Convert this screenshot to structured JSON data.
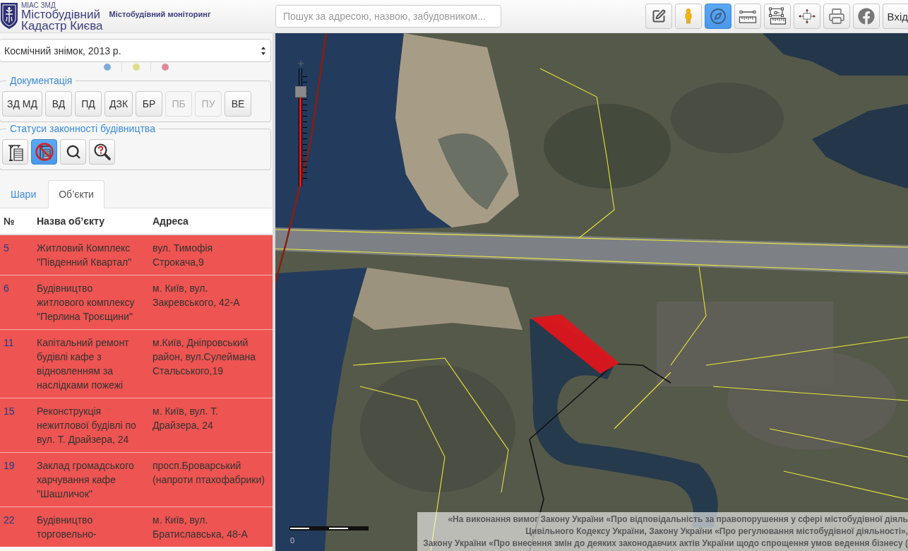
{
  "header": {
    "org": "МІАС ЗМД",
    "title_lines": [
      "Містобудівний",
      "Кадастр Києва"
    ],
    "subtitle": "Містобудівний моніторинг"
  },
  "search": {
    "placeholder": "Пошук за адресою, назвою, забудовником..."
  },
  "toolbar": {
    "buttons": [
      {
        "selected": false
      },
      {
        "selected": false
      },
      {
        "selected": true
      },
      {
        "selected": false
      },
      {
        "selected": false
      },
      {
        "selected": false
      },
      {
        "selected": false
      },
      {
        "selected": false
      }
    ],
    "login": "Вхід"
  },
  "sidebar": {
    "basemap_select": {
      "value": "Космічний знімок, 2013 р."
    },
    "layer_dots": [
      {
        "color": "#80aad9"
      },
      {
        "color": "#dcde8a"
      },
      {
        "color": "#de8a9c"
      }
    ],
    "documentation": {
      "legend": "Документація",
      "buttons": [
        {
          "label": "ЗД МД",
          "disabled": false
        },
        {
          "label": "ВД",
          "disabled": false
        },
        {
          "label": "ПД",
          "disabled": false
        },
        {
          "label": "ДЗК",
          "disabled": false
        },
        {
          "label": "БР",
          "disabled": false
        },
        {
          "label": "ПБ",
          "disabled": true
        },
        {
          "label": "ПУ",
          "disabled": true
        },
        {
          "label": "ВЕ",
          "disabled": false
        }
      ]
    },
    "statuses": {
      "legend": "Статуси законності будівництва",
      "buttons": [
        {
          "selected": false
        },
        {
          "selected": true
        },
        {
          "selected": false
        },
        {
          "selected": false
        }
      ]
    },
    "tabs": [
      {
        "label": "Шари",
        "selected": false
      },
      {
        "label": "Об’єкти",
        "selected": true
      }
    ],
    "table": {
      "columns": [
        "№",
        "Назва об’єкту",
        "Адреса"
      ],
      "rows": [
        {
          "number": "5",
          "name": "Житловий Комплекс \"Південний Квартал\"",
          "address": "вул. Тимофія Строкача,9"
        },
        {
          "number": "6",
          "name": "Будівництво житлового комплексу \"Перлина Троєщини\"",
          "address": "м. Київ, вул. Закревського, 42-А"
        },
        {
          "number": "11",
          "name": "Капітальний ремонт будівлі кафе з відновленням за наслідками пожежі",
          "address": "м.Київ, Дніпровський район, вул.Сулеймана Стальського,19"
        },
        {
          "number": "15",
          "name": "Реконструкція нежитлової будівлі по вул. Т. Драйзера, 24",
          "address": "м. Київ, вул. Т. Драйзера, 24"
        },
        {
          "number": "19",
          "name": "Заклад громадського харчування кафе \"Шашличок\"",
          "address": "просп.Броварський (напроти птахофабрики)"
        },
        {
          "number": "22",
          "name": "Будівництво торговельно-",
          "address": "м. Київ, вул. Братиславська, 48-А"
        }
      ]
    }
  },
  "map": {
    "zoom": {
      "level": 0.8
    },
    "scale_label": "0",
    "notice_lines": [
      "«На виконання вимог Закону України «Про відповідальність за правопорушення у сфері містобудівної діяль",
      "Цивільного Кодексу України, Закону України «Про регулювання містобудівної діяльності»,",
      "Закону України «Про внесення змін до деяких законодавчих актів України щодо спрощення умов ведення бізнесу ("
    ]
  }
}
